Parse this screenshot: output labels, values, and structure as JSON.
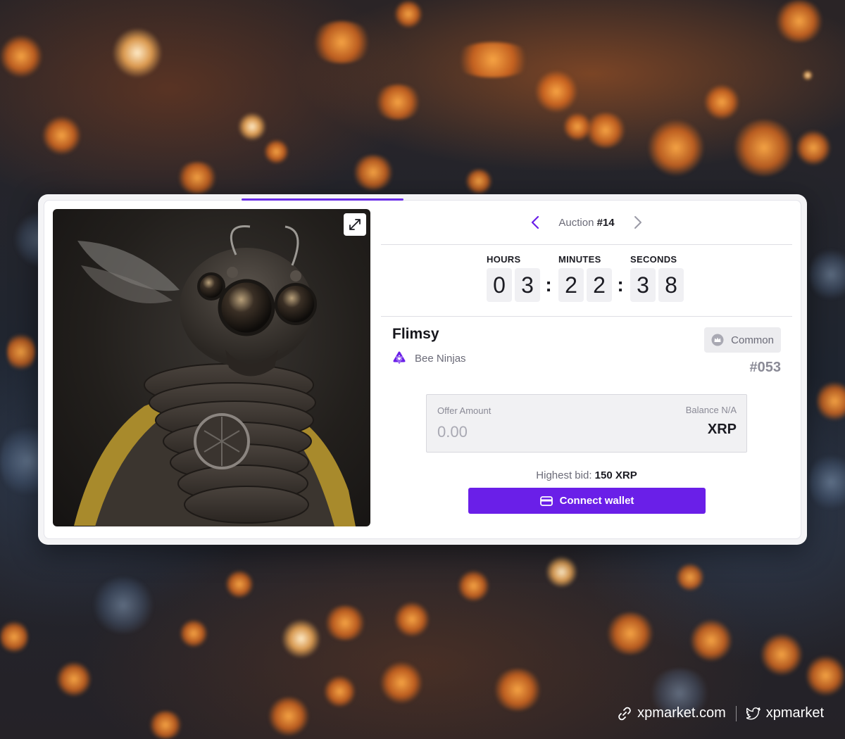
{
  "auction": {
    "label": "Auction",
    "number": "#14"
  },
  "timer": {
    "hours_label": "HOURS",
    "minutes_label": "MINUTES",
    "seconds_label": "SECONDS",
    "hours": [
      "0",
      "3"
    ],
    "minutes": [
      "2",
      "2"
    ],
    "seconds": [
      "3",
      "8"
    ],
    "separator": ":"
  },
  "nft": {
    "name": "Flimsy",
    "collection": "Bee Ninjas",
    "rarity": "Common",
    "number": "#053"
  },
  "offer": {
    "label": "Offer Amount",
    "placeholder": "0.00",
    "balance": "Balance N/A",
    "currency": "XRP"
  },
  "highest_bid": {
    "label": "Highest bid:",
    "value": "150 XRP"
  },
  "connect_button": {
    "label": "Connect wallet"
  },
  "footer": {
    "website": "xpmarket.com",
    "twitter": "xpmarket"
  },
  "colors": {
    "accent": "#6a1fe8",
    "card_bg": "#ffffff",
    "text_primary": "#1b1b22",
    "text_secondary": "#6b6b78"
  },
  "icons": {
    "expand": "expand-icon",
    "prev": "chevron-left-icon",
    "next": "chevron-right-icon",
    "collection": "collection-logo-icon",
    "rarity": "crown-icon",
    "wallet": "wallet-icon",
    "link": "link-icon",
    "twitter": "twitter-icon"
  }
}
